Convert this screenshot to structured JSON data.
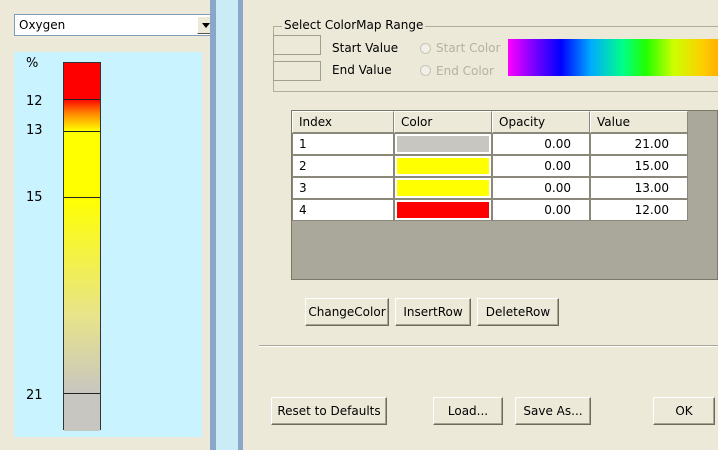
{
  "legend_panel": {
    "dropdown_value": "Oxygen",
    "unit_label": "%",
    "tick_labels": [
      "12",
      "13",
      "15",
      "21"
    ]
  },
  "colormap_range": {
    "group_title": "Select ColorMap Range",
    "start_value_label": "Start Value",
    "end_value_label": "End Value",
    "start_color_label": "Start Color",
    "end_color_label": "End Color",
    "start_value": "",
    "end_value": ""
  },
  "table": {
    "headers": [
      "Index",
      "Color",
      "Opacity",
      "Value"
    ],
    "rows": [
      {
        "index": "1",
        "color": "#c8c6c0",
        "opacity": "0.00",
        "value": "21.00"
      },
      {
        "index": "2",
        "color": "#ffff00",
        "opacity": "0.00",
        "value": "15.00"
      },
      {
        "index": "3",
        "color": "#ffff00",
        "opacity": "0.00",
        "value": "13.00"
      },
      {
        "index": "4",
        "color": "#ff0000",
        "opacity": "0.00",
        "value": "12.00"
      }
    ]
  },
  "table_buttons": {
    "change_color": "ChangeColor",
    "insert_row": "InsertRow",
    "delete_row": "DeleteRow"
  },
  "footer_buttons": {
    "reset": "Reset to Defaults",
    "load": "Load...",
    "save_as": "Save As...",
    "ok": "OK"
  },
  "colors": {
    "red": "#ff0000",
    "yellow": "#ffff00",
    "gray": "#c8c6c0",
    "legend_background": "#c9f3ff",
    "dialog_background": "#ece9d8"
  }
}
